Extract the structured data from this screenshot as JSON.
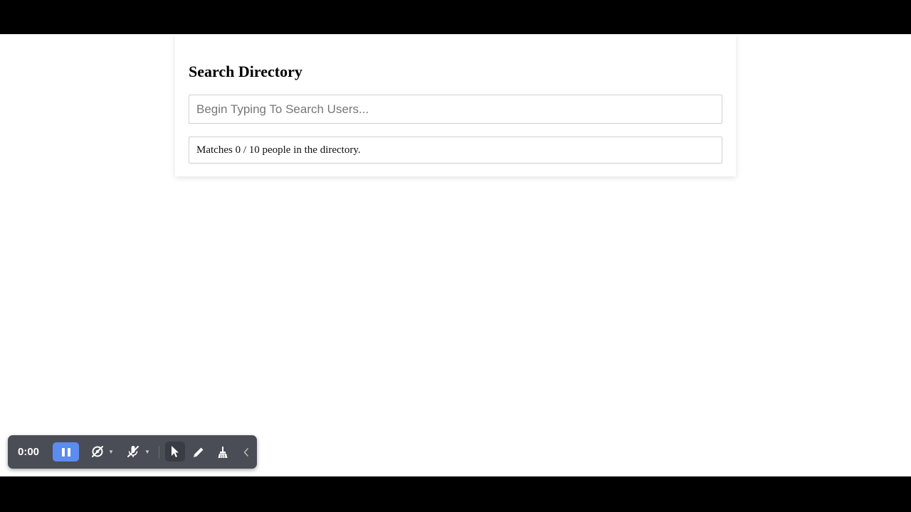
{
  "directory": {
    "title": "Search Directory",
    "search_placeholder": "Begin Typing To Search Users...",
    "search_value": "",
    "results_text": "Matches 0 / 10 people in the directory."
  },
  "recorder": {
    "timer": "0:00",
    "accent_color": "#5b8cf0",
    "icons": {
      "pause": "pause-icon",
      "camera_off": "camera-off-icon",
      "mic_off": "mic-off-icon",
      "cursor": "cursor-icon",
      "pen": "pen-icon",
      "eraser": "broom-icon",
      "collapse": "chevron-left-icon"
    }
  }
}
